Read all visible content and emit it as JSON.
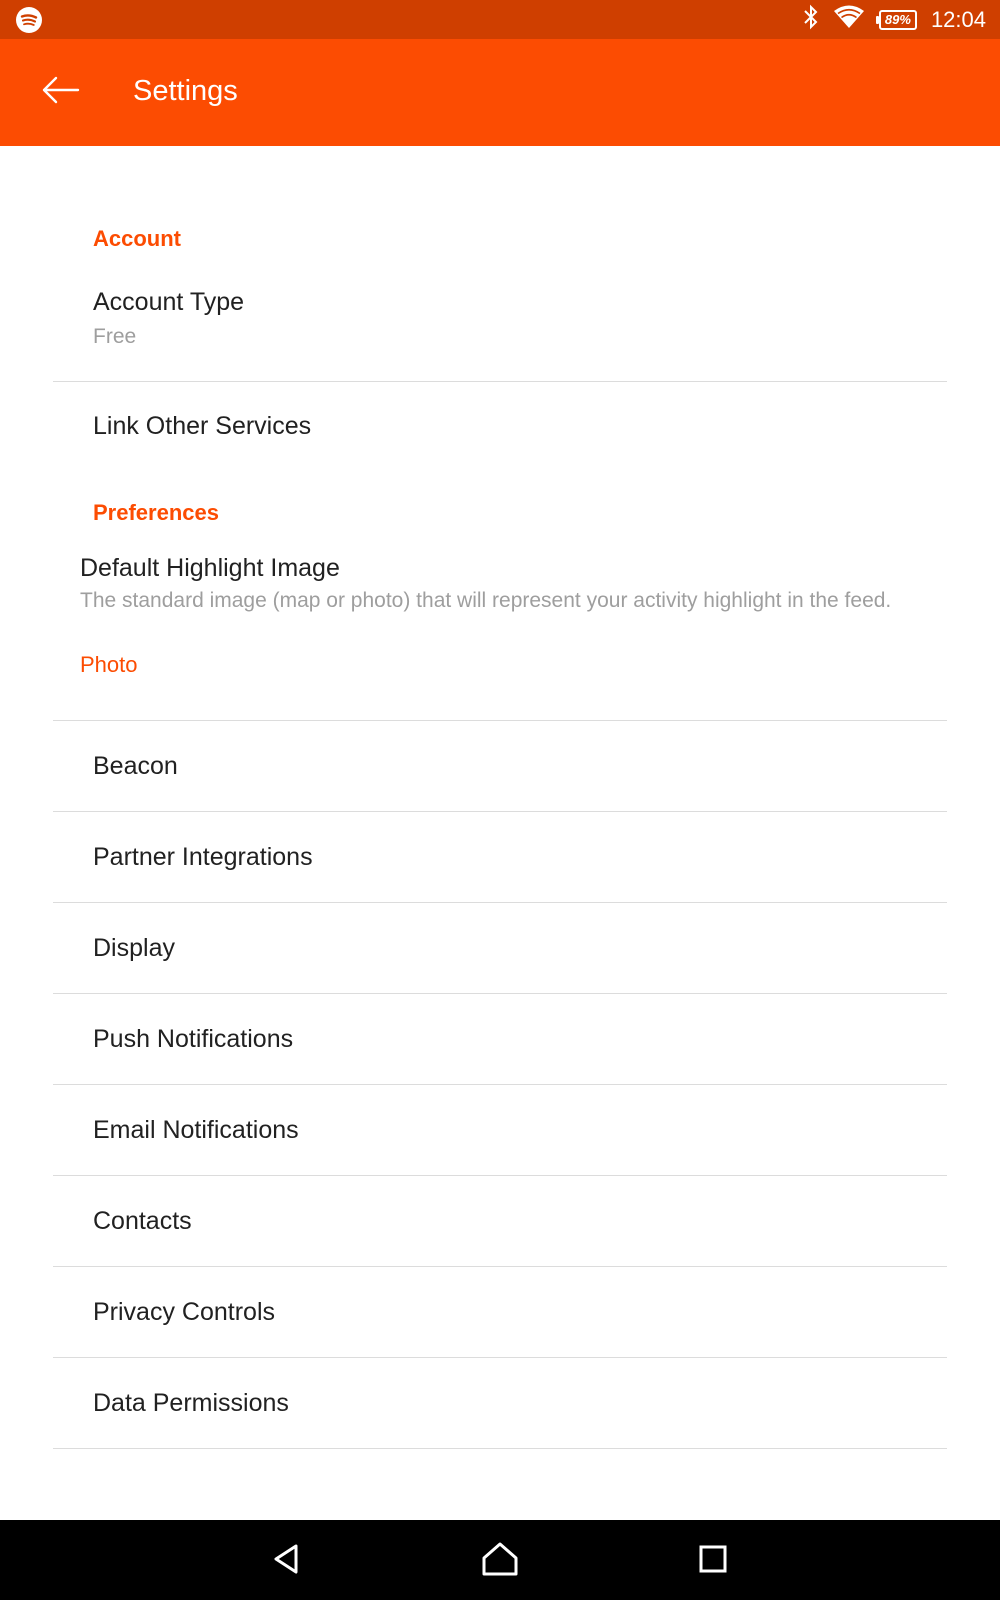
{
  "status_bar": {
    "app_icon": "spotify-icon",
    "bluetooth_icon": "bluetooth-icon",
    "wifi_icon": "wifi-icon",
    "battery_level": "89%",
    "time": "12:04"
  },
  "app_bar": {
    "back_icon": "arrow-left-icon",
    "title": "Settings",
    "color": "#fc4c02"
  },
  "sections": {
    "account": {
      "header": "Account",
      "account_type": {
        "title": "Account Type",
        "value": "Free"
      },
      "link_services": {
        "title": "Link Other Services"
      }
    },
    "preferences": {
      "header": "Preferences",
      "default_highlight": {
        "title": "Default Highlight Image",
        "description": "The standard image (map or photo) that will represent your activity highlight in the feed.",
        "value": "Photo"
      },
      "items": [
        {
          "title": "Beacon"
        },
        {
          "title": "Partner Integrations"
        },
        {
          "title": "Display"
        },
        {
          "title": "Push Notifications"
        },
        {
          "title": "Email Notifications"
        },
        {
          "title": "Contacts"
        },
        {
          "title": "Privacy Controls"
        },
        {
          "title": "Data Permissions"
        }
      ]
    }
  },
  "nav_bar": {
    "back": "triangle-back-icon",
    "home": "home-icon",
    "recents": "square-recents-icon"
  }
}
